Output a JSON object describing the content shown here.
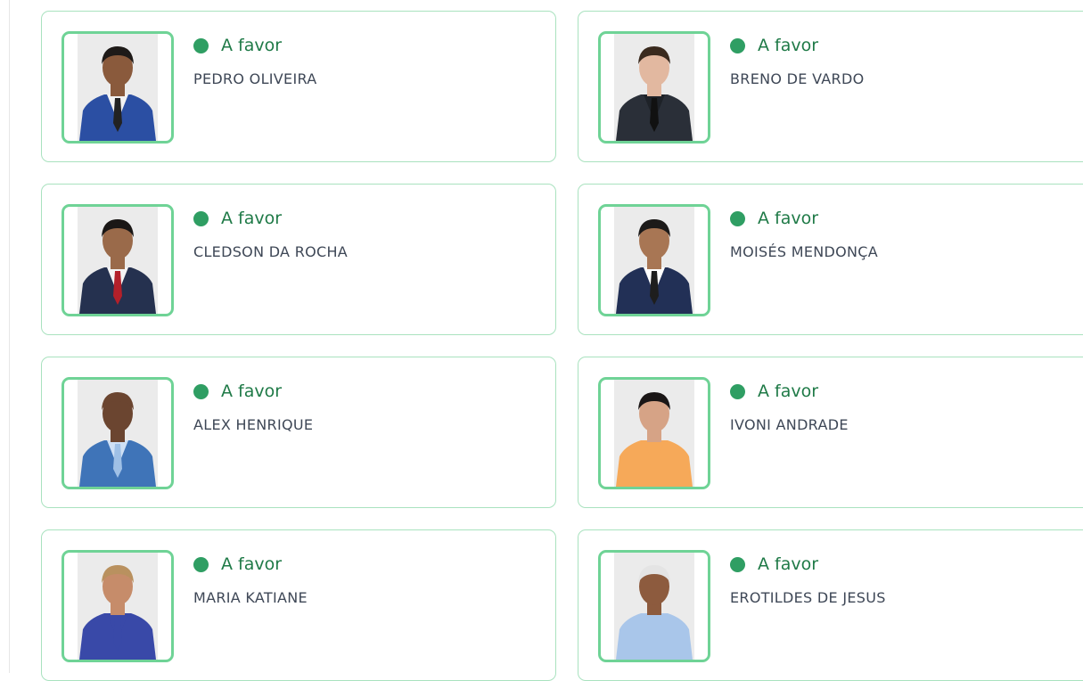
{
  "colors": {
    "card_border": "#a9e2bf",
    "photo_border": "#6fd396",
    "status_dot": "#2f9e63",
    "status_text": "#1f7a47",
    "name_text": "#3e4756"
  },
  "cards": [
    {
      "status": "A favor",
      "name": "PEDRO OLIVEIRA",
      "portrait": {
        "skin": "#8a5a3c",
        "hair": "#1e1a18",
        "suit": "#2b4fa3",
        "shirt": "#f2f2f2",
        "tie": "#222222"
      }
    },
    {
      "status": "A favor",
      "name": "BRENO DE VARDO",
      "portrait": {
        "skin": "#e2b8a0",
        "hair": "#3a2a1e",
        "suit": "#2a2f38",
        "shirt": "#1e2228",
        "tie": "#111111"
      }
    },
    {
      "status": "A favor",
      "name": "CLEDSON DA ROCHA",
      "portrait": {
        "skin": "#9a6a4a",
        "hair": "#1a1716",
        "suit": "#25314f",
        "shirt": "#f4f4f4",
        "tie": "#b3202a"
      }
    },
    {
      "status": "A favor",
      "name": "MOISÉS MENDONÇA",
      "portrait": {
        "skin": "#a87654",
        "hair": "#1c1a19",
        "suit": "#223056",
        "shirt": "#ffffff",
        "tie": "#1e1e1e"
      }
    },
    {
      "status": "A favor",
      "name": "ALEX HENRIQUE",
      "portrait": {
        "skin": "#6b4530",
        "hair": "#6b4530",
        "suit": "#3f74b8",
        "shirt": "#cfe0f5",
        "tie": "#9fc0e6"
      }
    },
    {
      "status": "A favor",
      "name": "IVONI ANDRADE",
      "portrait": {
        "skin": "#d6a386",
        "hair": "#1a1616",
        "suit": "#f6a959",
        "shirt": "#f6a959",
        "tie": "#f6a959"
      }
    },
    {
      "status": "A favor",
      "name": "MARIA KATIANE",
      "portrait": {
        "skin": "#c68c6a",
        "hair": "#b9915f",
        "suit": "#3949a8",
        "shirt": "#3949a8",
        "tie": "#3949a8"
      }
    },
    {
      "status": "A favor",
      "name": "EROTILDES DE JESUS",
      "portrait": {
        "skin": "#8d5b3e",
        "hair": "#e4e4e4",
        "suit": "#a9c6ea",
        "shirt": "#a9c6ea",
        "tie": "#a9c6ea"
      }
    }
  ]
}
